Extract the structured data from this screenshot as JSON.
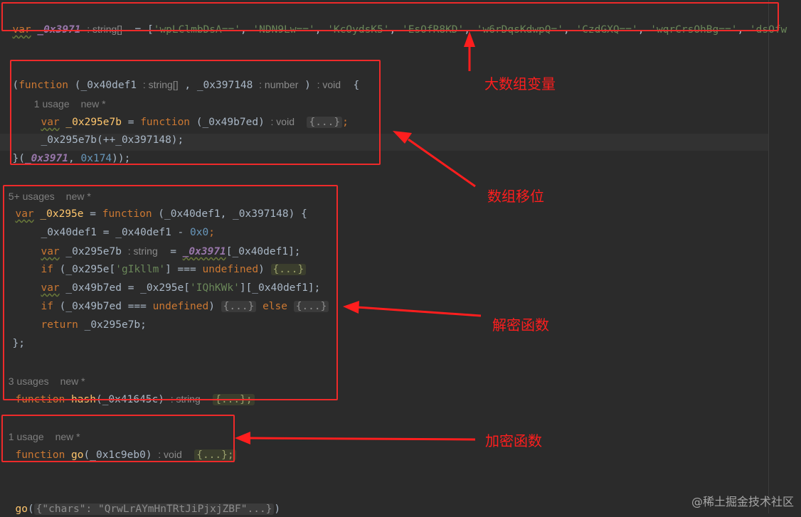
{
  "code": {
    "l1": {
      "kw": "var",
      "name": "_0x3971",
      "hint": ": string[]",
      "eq": "=",
      "open": "[",
      "strs": [
        "'wpLClmbDsA=='",
        "'NDN9Lw=='",
        "'KcOydsK5'",
        "'EsOfR8KD'",
        "'w6rDqsKdwpQ='",
        "'CzdGXQ=='",
        "'wqrCrsOhBg=='",
        "'dsOfw"
      ],
      "sep": ", "
    },
    "l2": {
      "open": "(",
      "kw": "function",
      "p1": "_0x40def1",
      "h1": ": string[]",
      "comma": ",",
      "p2": "_0x397148",
      "h2": ": number",
      "close": ")",
      "h3": ": void",
      "brace": "{"
    },
    "l3": {
      "usage": "1 usage",
      "new": "new *"
    },
    "l4": {
      "kw": "var",
      "name": "_0x295e7b",
      "eq": "=",
      "kw2": "function",
      "param": "(_0x49b7ed)",
      "hint": ": void",
      "fold": "{...}",
      "semi": ";"
    },
    "l5": {
      "text": "_0x295e7b(++_0x397148);"
    },
    "l6": {
      "pre": "}(",
      "name": "_0x3971",
      "mid": ", ",
      "num": "0x174",
      "post": "));"
    },
    "l7": {
      "usage": "5+ usages",
      "new": "new *"
    },
    "l8": {
      "kw": "var",
      "name": "_0x295e",
      "eq": "=",
      "kw2": "function",
      "args": "(_0x40def1, _0x397148) {"
    },
    "l9": {
      "a": "_0x40def1 = _0x40def1 - ",
      "num": "0x0",
      "semi": ";"
    },
    "l10": {
      "kw": "var",
      "name": "_0x295e7b",
      "hint": ": string",
      "eq": "=",
      "arr": "_0x3971",
      "idx": "[_0x40def1];"
    },
    "l11": {
      "kw": "if",
      "a": " (_0x295e[",
      "str": "'gIkllm'",
      "b": "] === ",
      "kw2": "undefined",
      "c": ") ",
      "fold": "{...}"
    },
    "l12": {
      "kw": "var",
      "a": " _0x49b7ed = _0x295e[",
      "str": "'IQhKWk'",
      "b": "][_0x40def1];"
    },
    "l13": {
      "kw": "if",
      "a": " (_0x49b7ed === ",
      "kw2": "undefined",
      "c": ") ",
      "fold1": "{...}",
      "else": "else",
      "fold2": "{...}"
    },
    "l14": {
      "kw": "return",
      "a": " _0x295e7b;"
    },
    "l15": {
      "text": "};"
    },
    "l16": {
      "usage": "3 usages",
      "new": "new *"
    },
    "l17": {
      "kw": "function",
      "name": "hash",
      "args": "(_0x41645c)",
      "hint": ": string",
      "fold": "{...};"
    },
    "l18": {
      "usage": "1 usage",
      "new": "new *"
    },
    "l19": {
      "kw": "function",
      "name": "go",
      "args": "(_0x1c9eb0)",
      "hint": ": void",
      "fold": "{...};"
    },
    "l20": {
      "name": "go",
      "open": "(",
      "fold": "{\"chars\": \"QrwLrAYmHnTRtJiPjxjZBF\"...}",
      "close": ")"
    }
  },
  "annotations": {
    "big_array": "大数组变量",
    "shift": "数组移位",
    "decrypt": "解密函数",
    "encrypt": "加密函数"
  },
  "watermark": "@稀土掘金技术社区",
  "colors": {
    "annotation": "#ff1e1e",
    "keyword": "#cc7832",
    "function": "#ffc66d",
    "string": "#6a8759",
    "number": "#6897bb",
    "property": "#9876aa"
  }
}
